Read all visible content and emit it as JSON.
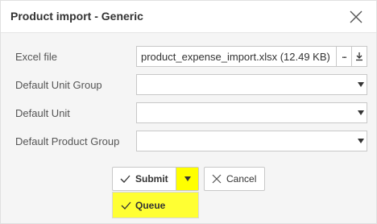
{
  "dialog": {
    "title": "Product import - Generic",
    "close_icon": "close-icon"
  },
  "form": {
    "excel_file": {
      "label": "Excel file",
      "value": "product_expense_import.xlsx (12.49 KB)",
      "more_button": "...",
      "download_icon": "download-icon"
    },
    "default_unit_group": {
      "label": "Default Unit Group",
      "value": ""
    },
    "default_unit": {
      "label": "Default Unit",
      "value": ""
    },
    "default_product_group": {
      "label": "Default Product Group",
      "value": ""
    }
  },
  "actions": {
    "submit_label": "Submit",
    "cancel_label": "Cancel",
    "caret_highlight_color": "#ffff00"
  },
  "submit_menu": {
    "items": [
      {
        "label": "Queue"
      }
    ],
    "highlight_color": "#ffff33"
  }
}
